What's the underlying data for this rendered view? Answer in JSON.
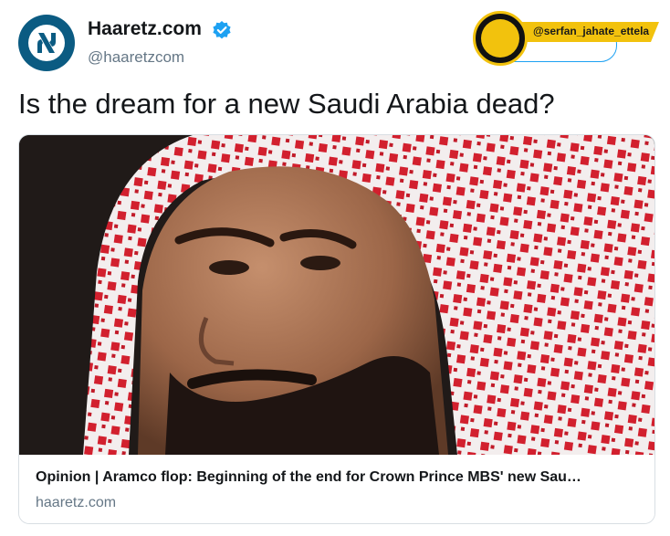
{
  "account": {
    "display_name": "Haaretz.com",
    "handle": "@haaretzcom",
    "avatar_icon": "haaretz-logo-icon",
    "verified_icon": "verified-badge-icon",
    "avatar_color": "#0b5b82"
  },
  "watermark": {
    "handle": "@serfan_jahate_ettela",
    "logo_icon": "ettela-logo-icon",
    "color": "#f2c20d"
  },
  "tweet": {
    "text": "Is the dream for a new Saudi Arabia dead?"
  },
  "card": {
    "image_icon": "article-photo",
    "title": "Opinion | Aramco flop: Beginning of the end for Crown Prince MBS' new Sau…",
    "domain": "haaretz.com"
  }
}
